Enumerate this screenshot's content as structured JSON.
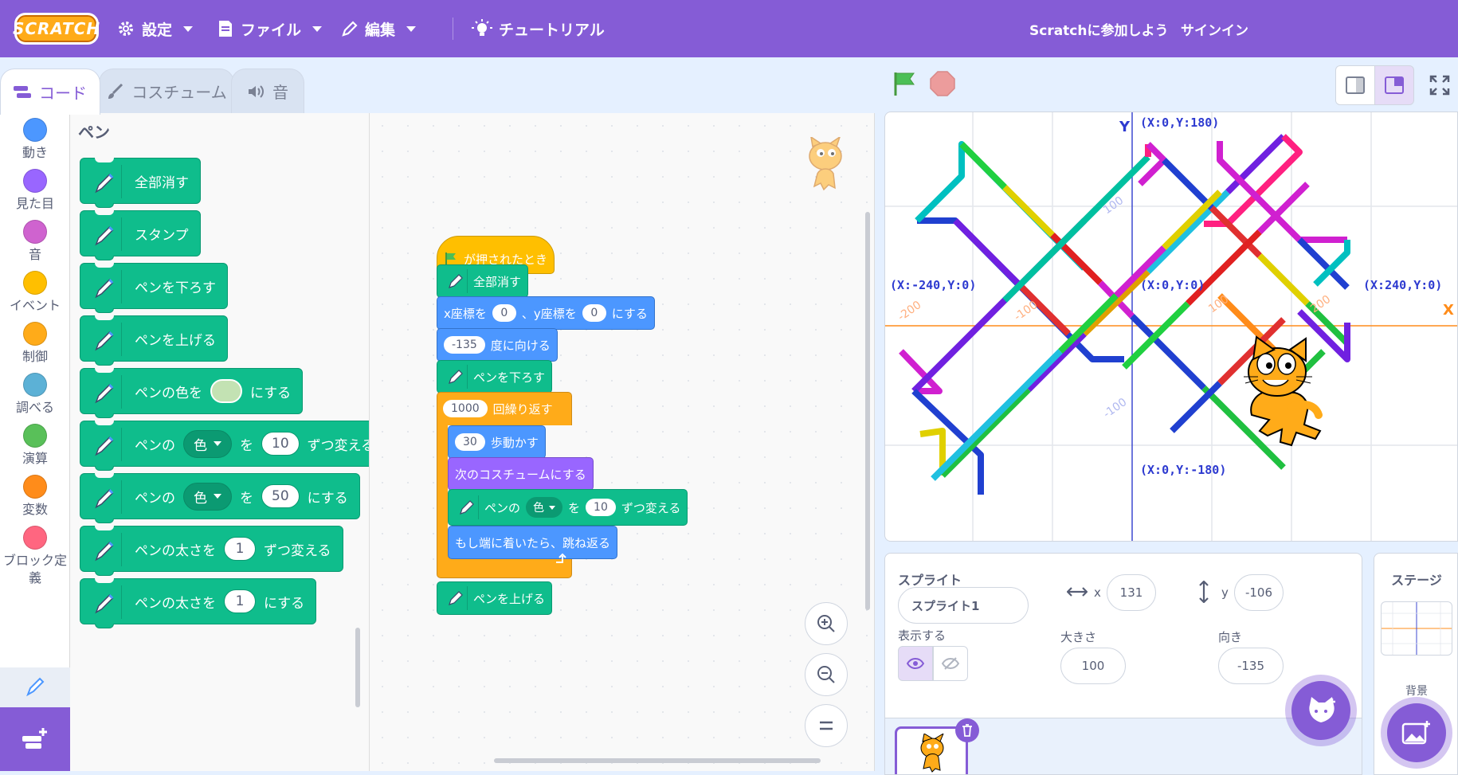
{
  "menubar": {
    "logo": "SCRATCH",
    "settings": "設定",
    "file": "ファイル",
    "edit": "編集",
    "tutorial": "チュートリアル",
    "join": "Scratchに参加しよう",
    "signin": "サインイン"
  },
  "tabs": {
    "code": "コード",
    "costume": "コスチューム",
    "sound": "音"
  },
  "categories": [
    {
      "label": "動き",
      "color": "#4c97ff"
    },
    {
      "label": "見た目",
      "color": "#9966ff"
    },
    {
      "label": "音",
      "color": "#cf63cf"
    },
    {
      "label": "イベント",
      "color": "#ffbf00"
    },
    {
      "label": "制御",
      "color": "#ffab19"
    },
    {
      "label": "調べる",
      "color": "#5cb1d6"
    },
    {
      "label": "演算",
      "color": "#59c059"
    },
    {
      "label": "変数",
      "color": "#ff8c1a"
    },
    {
      "label": "ブロック定義",
      "color": "#ff6680"
    }
  ],
  "palette": {
    "title": "ペン",
    "clear": "全部消す",
    "stamp": "スタンプ",
    "pen_down": "ペンを下ろす",
    "pen_up": "ペンを上げる",
    "set_color_pre": "ペンの色を",
    "set_color_post": "にする",
    "change_param_pre": "ペンの",
    "param_color": "色",
    "wo": "を",
    "change_value": "10",
    "change_post": "ずつ変える",
    "set_value": "50",
    "set_post": "にする",
    "change_size": "ペンの太さを",
    "size_change_value": "1",
    "size_set_value": "1"
  },
  "script": {
    "hat": "が押されたとき",
    "clear": "全部消す",
    "goto_x_label": "x座標を",
    "goto_x": "0",
    "goto_y_label": "、y座標を",
    "goto_y": "0",
    "goto_post": "にする",
    "point_value": "-135",
    "point_label": "度に向ける",
    "pen_down": "ペンを下ろす",
    "repeat_value": "1000",
    "repeat_label": "回繰り返す",
    "move_value": "30",
    "move_label": "歩動かす",
    "next_costume": "次のコスチュームにする",
    "change_pre": "ペンの",
    "change_param": "色",
    "change_wo": "を",
    "change_value": "10",
    "change_post": "ずつ変える",
    "bounce": "もし端に着いたら、跳ね返る",
    "pen_up": "ペンを上げる"
  },
  "stage": {
    "label_top": "(X:0,Y:180)",
    "label_bottom": "(X:0,Y:-180)",
    "label_left": "(X:-240,Y:0)",
    "label_right": "(X:240,Y:0)",
    "label_center": "(X:0,Y:0)",
    "axis_y": "Y",
    "axis_x": "X",
    "tick_x_neg200": "-200",
    "tick_x_neg100": "-100",
    "tick_x_100": "100",
    "tick_x_200": "200",
    "tick_y_100": "100",
    "tick_y_neg100": "-100"
  },
  "sprite": {
    "header": "スプライト",
    "name": "スプライト1",
    "x_label": "x",
    "x": "131",
    "y_label": "y",
    "y": "-106",
    "show_label": "表示する",
    "size_label": "大きさ",
    "size": "100",
    "direction_label": "向き",
    "direction": "-135"
  },
  "stage_pane": {
    "title": "ステージ",
    "backdrops_label": "背景"
  }
}
